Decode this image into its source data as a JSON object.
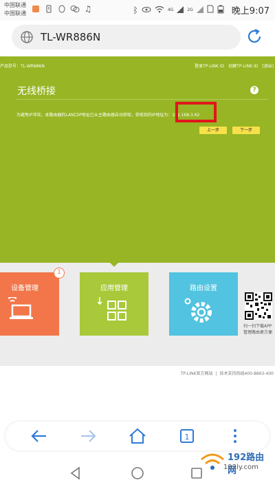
{
  "status_bar": {
    "carrier_1": "中国联通",
    "carrier_2": "中国联通",
    "signal_1": "4G",
    "signal_2": "2G",
    "time": "晚上9:07"
  },
  "browser": {
    "url": "TL-WR886N"
  },
  "router_page": {
    "model_label": "产品型号：TL-WR886N",
    "login_link": "登录TP-LINK ID",
    "create_link": "创建TP-LINK ID",
    "exit_link": "[退出]",
    "section_title": "无线桥接",
    "help_label": "?",
    "message": "为避免IP冲突，本路由器的LAN口IP地址已从主路由器自动获取，获取到的IP地址为：",
    "ip_value": "192.168.3.62",
    "prev_button": "上一步",
    "next_button": "下一步"
  },
  "tiles": [
    {
      "label": "设备管理",
      "badge": "1"
    },
    {
      "label": "应用管理"
    },
    {
      "label": "路由设置"
    }
  ],
  "qr": {
    "caption_1": "扫一扫下载APP",
    "caption_2": "管理路由更方便"
  },
  "footer": {
    "site": "TP-LINK官方网站",
    "separator": "|",
    "hotline": "技术支持热线400-8863-400"
  },
  "watermark": {
    "title": "192路由网",
    "url": "192ly.com"
  },
  "colors": {
    "green": "#97b524",
    "orange": "#f2764a",
    "lime": "#a9c93a",
    "cyan": "#52c3e0",
    "accent_blue": "#2e7bd6",
    "highlight_red": "#e0161c"
  }
}
